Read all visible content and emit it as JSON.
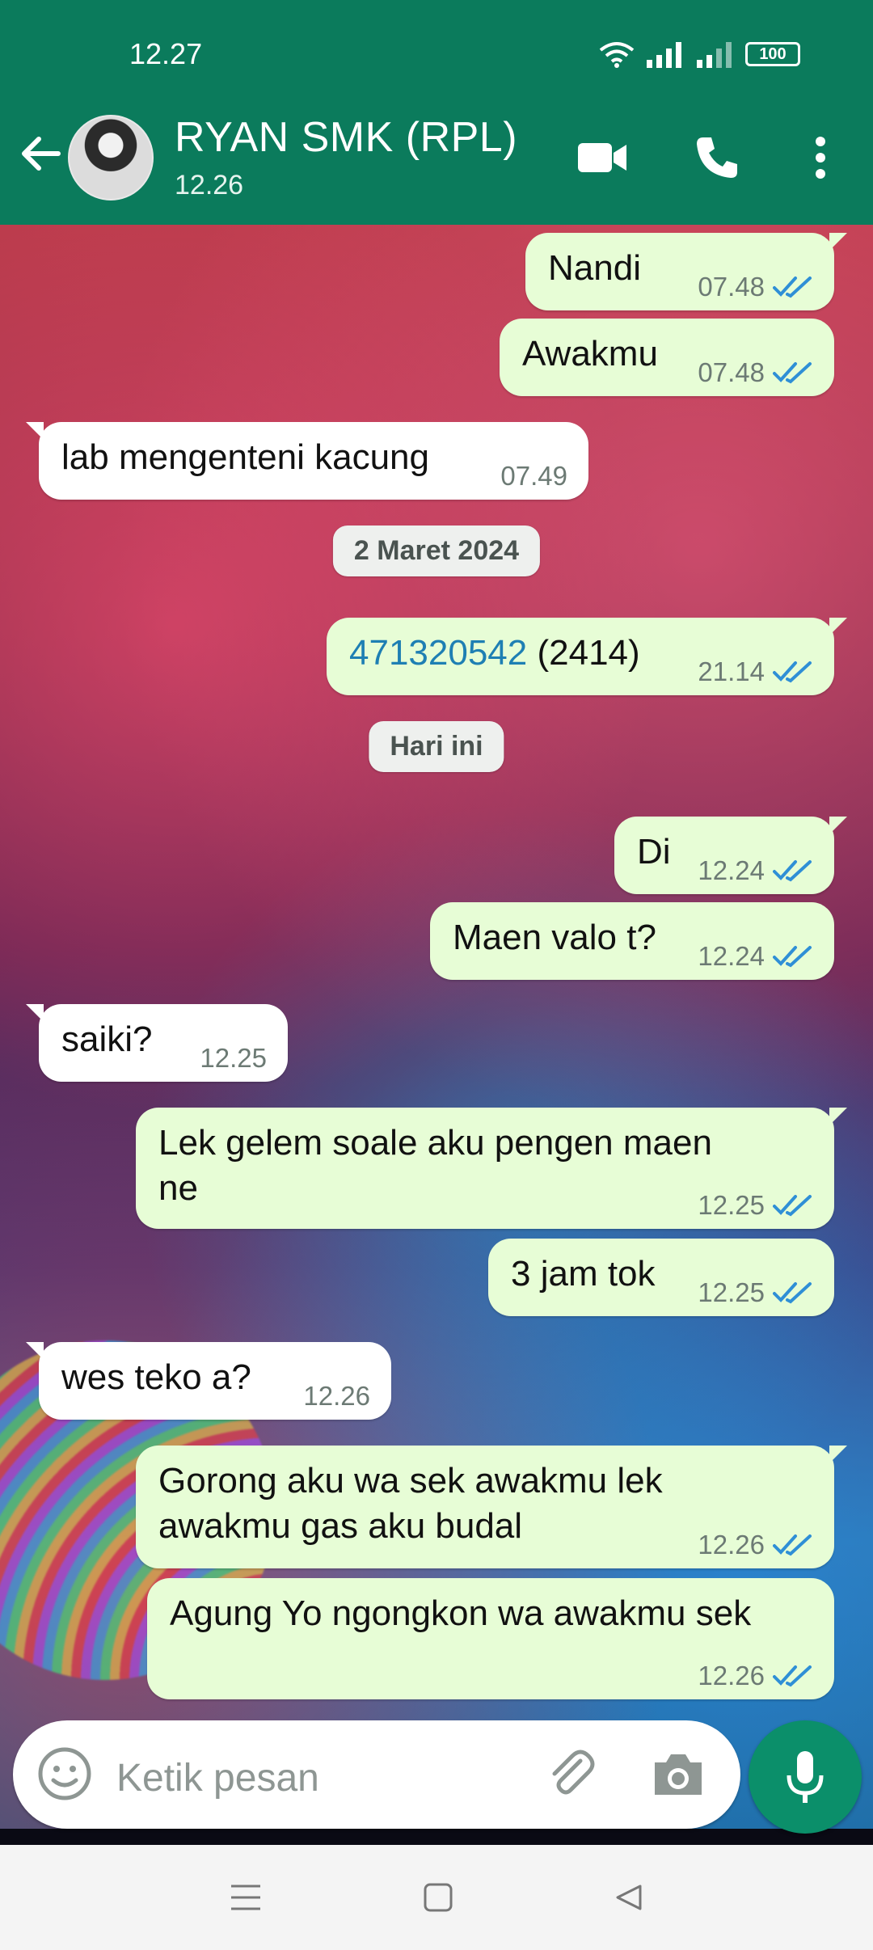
{
  "status": {
    "time": "12.27",
    "battery": "100"
  },
  "header": {
    "name": "RYAN SMK (RPL)",
    "last_seen": "12.26"
  },
  "messages": [
    {
      "text": "Nandi",
      "time": "07.48"
    },
    {
      "text": "Awakmu",
      "time": "07.48"
    },
    {
      "text": "lab mengenteni kacung",
      "time": "07.49"
    },
    {
      "date": "2 Maret 2024"
    },
    {
      "link": "471320542",
      "text": "(2414)",
      "time": "21.14"
    },
    {
      "date": "Hari ini"
    },
    {
      "text": "Di",
      "time": "12.24"
    },
    {
      "text": "Maen valo t?",
      "time": "12.24"
    },
    {
      "text": "saiki?",
      "time": "12.25"
    },
    {
      "text": "Lek gelem soale aku pengen maen\nne",
      "time": "12.25"
    },
    {
      "text": "3 jam tok",
      "time": "12.25"
    },
    {
      "text": "wes teko a?",
      "time": "12.26"
    },
    {
      "text": "Gorong aku wa sek awakmu lek\nawakmu gas aku budal",
      "time": "12.26"
    },
    {
      "text": "Agung Yo ngongkon wa awakmu sek",
      "time": "12.26"
    }
  ],
  "composer": {
    "placeholder": "Ketik pesan"
  },
  "colors": {
    "header": "#0b7b5c",
    "outgoing": "#e7fdd6",
    "incoming": "#ffffff",
    "read_tick": "#2f8fd6",
    "mic": "#0b8f6a"
  },
  "icons": [
    "back-arrow-icon",
    "video-call-icon",
    "phone-icon",
    "more-icon",
    "emoji-icon",
    "attach-icon",
    "camera-icon",
    "mic-icon",
    "wifi-icon",
    "signal-icon",
    "battery-icon",
    "nav-menu-icon",
    "nav-home-icon",
    "nav-back-icon",
    "double-check-icon"
  ]
}
